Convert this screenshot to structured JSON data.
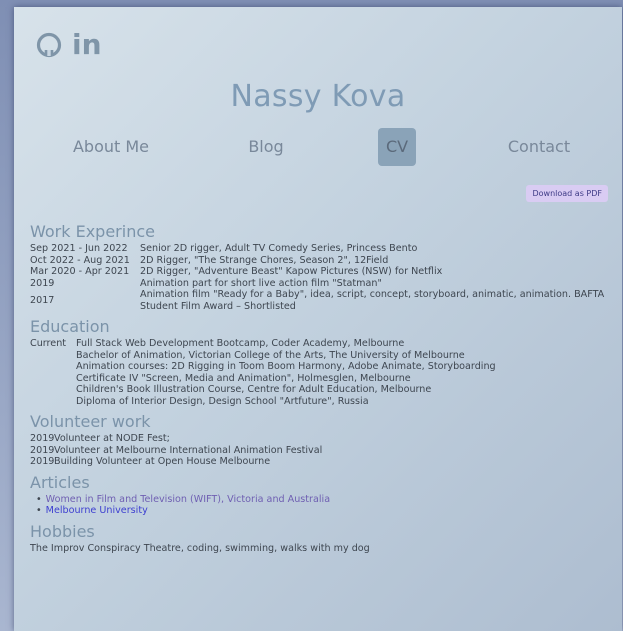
{
  "header": {
    "social": [
      {
        "icon": "github-icon"
      },
      {
        "icon": "linkedin-icon",
        "text": "in"
      }
    ],
    "name": "Nassy Kova",
    "nav": [
      {
        "label": "About Me",
        "active": false
      },
      {
        "label": "Blog",
        "active": false
      },
      {
        "label": "CV",
        "active": true
      },
      {
        "label": "Contact",
        "active": false
      }
    ],
    "download_label": "Download as PDF"
  },
  "work": {
    "title": "Work Experince",
    "items": [
      {
        "date": "Sep 2021 - Jun 2022",
        "desc": "Senior 2D rigger, Adult TV Comedy Series, Princess Bento"
      },
      {
        "date": "Oct 2022 - Aug 2021",
        "desc": "2D Rigger, \"The Strange Chores, Season 2\", 12Field"
      },
      {
        "date": "Mar 2020 - Apr 2021",
        "desc": "2D Rigger, \"Adventure Beast\" Kapow Pictures (NSW) for Netflix"
      },
      {
        "date": "2019",
        "desc": "Animation part for short live action film \"Statman\""
      },
      {
        "date": "2017",
        "desc": "Animation film \"Ready for a Baby\", idea, script, concept, storyboard, animatic, animation. BAFTA Student Film Award – Shortlisted"
      }
    ]
  },
  "education": {
    "title": "Education",
    "items": [
      {
        "date": "Current",
        "desc": "Full Stack Web Development Bootcamp, Coder Academy, Melbourne"
      },
      {
        "date": "",
        "desc": "Bachelor of Animation, Victorian College of the Arts, The University of Melbourne"
      },
      {
        "date": "",
        "desc": "Animation courses: 2D Rigging in Toom Boom Harmony, Adobe Animate, Storyboarding"
      },
      {
        "date": "",
        "desc": "Certificate IV \"Screen, Media and Animation\", Holmesglen, Melbourne"
      },
      {
        "date": "",
        "desc": "Children's Book Illustration Course, Centre for Adult Education, Melbourne"
      },
      {
        "date": "",
        "desc": "Diploma of Interior Design, Design School \"Artfuture\", Russia"
      }
    ]
  },
  "volunteer": {
    "title": "Volunteer work",
    "items": [
      {
        "date": "2019",
        "desc": "Volunteer at NODE Fest;"
      },
      {
        "date": "2019",
        "desc": "Volunteer at Melbourne International Animation Festival"
      },
      {
        "date": "2019",
        "desc": "Building Volunteer at Open House Melbourne"
      }
    ]
  },
  "articles": {
    "title": "Articles",
    "items": [
      {
        "label": "Women in Film and Television (WIFT), Victoria and Australia"
      },
      {
        "label": "Melbourne University"
      }
    ]
  },
  "hobbies": {
    "title": "Hobbies",
    "text": "The Improv Conspiracy Theatre, coding, swimming, walks with my dog"
  }
}
